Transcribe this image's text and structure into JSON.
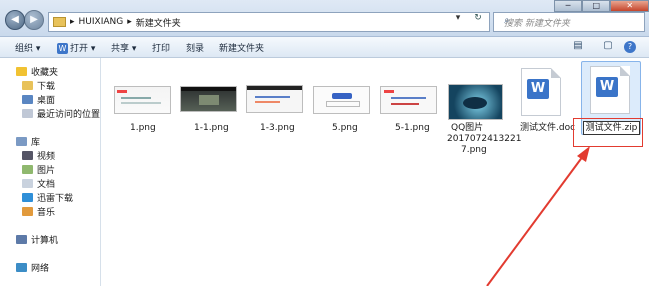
{
  "address": {
    "back_glyph": "◀",
    "forward_glyph": "▶",
    "segments": [
      "▸",
      "HUIXIANG",
      "▸",
      "新建文件夹"
    ],
    "dropdown_glyph": "▾",
    "refresh_glyph": "↻",
    "search_placeholder": "搜索 新建文件夹",
    "search_icon": "⌕"
  },
  "window_controls": {
    "minimize": "─",
    "maximize": "□",
    "close": "✕"
  },
  "toolbar": {
    "organize": "组织 ▾",
    "open_icon": "W",
    "open": "打开 ▾",
    "share": "共享 ▾",
    "print": "打印",
    "burn": "刻录",
    "new_folder": "新建文件夹",
    "view_icon": "▤",
    "preview_icon": "▢",
    "help_icon": "?"
  },
  "sidebar": {
    "favorites": "收藏夹",
    "downloads": "下载",
    "desktop": "桌面",
    "recent": "最近访问的位置",
    "libraries": "库",
    "videos": "视频",
    "pictures": "图片",
    "documents": "文档",
    "xunlei": "迅雷下载",
    "music": "音乐",
    "computer": "计算机",
    "network": "网络"
  },
  "files": [
    {
      "name": "1.png",
      "type": "image"
    },
    {
      "name": "1-1.png",
      "type": "image"
    },
    {
      "name": "1-3.png",
      "type": "image"
    },
    {
      "name": "5.png",
      "type": "image"
    },
    {
      "name": "5-1.png",
      "type": "image"
    },
    {
      "name_line1": "QQ图片",
      "name_line2": "2017072413221",
      "name_line3": "7.png",
      "type": "image"
    },
    {
      "name": "测试文件.doc",
      "type": "word-document",
      "logo": "W"
    },
    {
      "name": "测试文件.zip",
      "type": "word-document",
      "logo": "W",
      "state": "renaming"
    }
  ],
  "colors": {
    "annotation_red": "#e23b30",
    "selection": "#dcebfb",
    "word_blue": "#3a74c8"
  }
}
